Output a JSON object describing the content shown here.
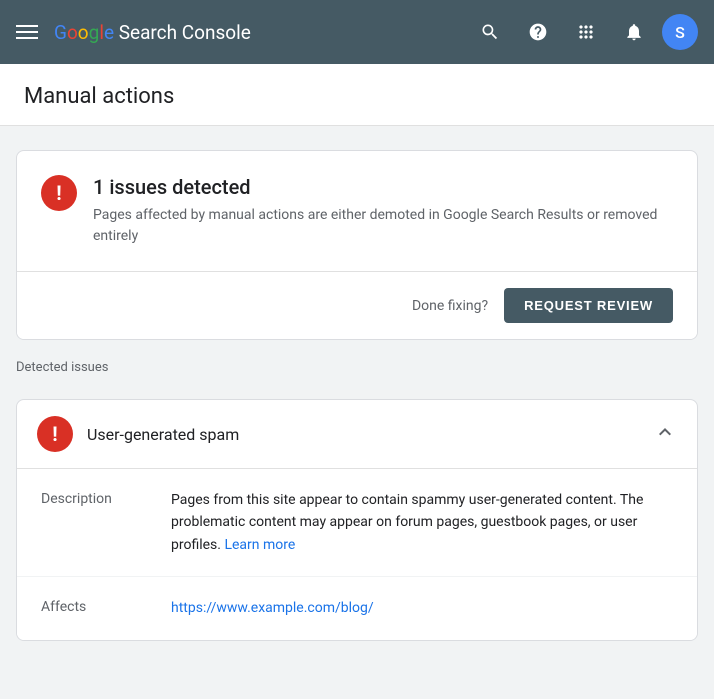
{
  "topnav": {
    "logo_text": "Google Search Console",
    "icons": {
      "search": "🔍",
      "help": "?",
      "apps": "⠿",
      "notifications": "🔔"
    },
    "avatar_letter": "S"
  },
  "page_title": "Manual actions",
  "issues_card": {
    "count_label": "1 issues detected",
    "description": "Pages affected by manual actions are either demoted in Google Search Results or removed entirely",
    "done_fixing_label": "Done fixing?",
    "request_review_label": "REQUEST REVIEW"
  },
  "detected_issues_label": "Detected issues",
  "issue_item": {
    "title": "User-generated spam",
    "description_label": "Description",
    "description_text": "Pages from this site appear to contain spammy user-generated content. The problematic content may appear on forum pages, guestbook pages, or user profiles.",
    "learn_more_label": "Learn more",
    "affects_label": "Affects",
    "affects_url": "https://www.example.com/blog/"
  }
}
